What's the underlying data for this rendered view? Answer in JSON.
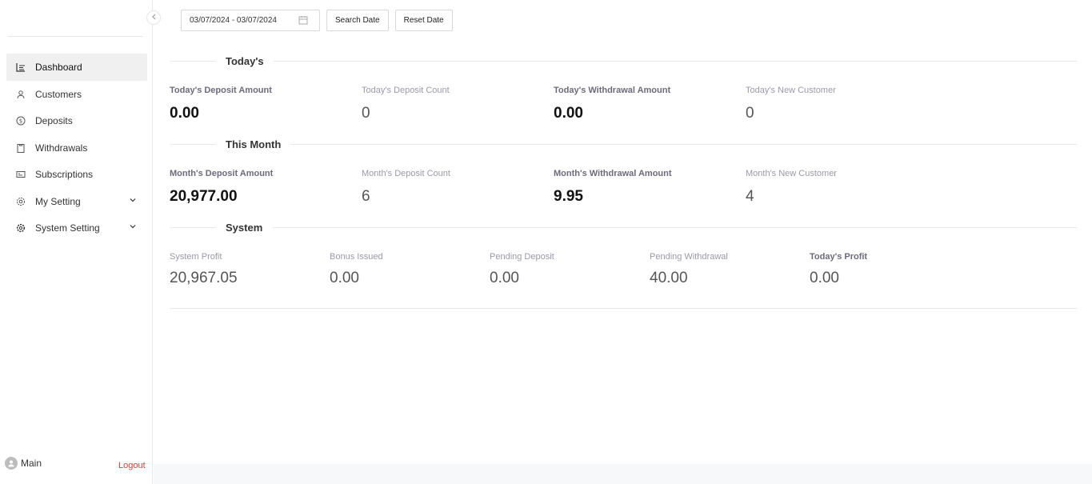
{
  "sidebar": {
    "items": [
      {
        "label": "Dashboard",
        "icon": "dashboard-icon",
        "active": true
      },
      {
        "label": "Customers",
        "icon": "user-icon"
      },
      {
        "label": "Deposits",
        "icon": "dollar-icon"
      },
      {
        "label": "Withdrawals",
        "icon": "clipboard-icon"
      },
      {
        "label": "Subscriptions",
        "icon": "card-icon"
      },
      {
        "label": "My Setting",
        "icon": "settings-icon",
        "expandable": true
      },
      {
        "label": "System Setting",
        "icon": "gear-icon",
        "expandable": true
      }
    ],
    "user_name": "Main",
    "logout_label": "Logout"
  },
  "toolbar": {
    "date_range": "03/07/2024 - 03/07/2024",
    "search_label": "Search Date",
    "reset_label": "Reset Date"
  },
  "todays": {
    "title": "Today's",
    "stats": [
      {
        "label": "Today's Deposit Amount",
        "value": "0.00"
      },
      {
        "label": "Today's Deposit Count",
        "value": "0"
      },
      {
        "label": "Today's Withdrawal Amount",
        "value": "0.00"
      },
      {
        "label": "Today's New Customer",
        "value": "0"
      }
    ]
  },
  "month": {
    "title": "This Month",
    "stats": [
      {
        "label": "Month's Deposit Amount",
        "value": "20,977.00"
      },
      {
        "label": "Month's Deposit Count",
        "value": "6"
      },
      {
        "label": "Month's Withdrawal Amount",
        "value": "9.95"
      },
      {
        "label": "Month's New Customer",
        "value": "4"
      }
    ]
  },
  "system": {
    "title": "System",
    "stats": [
      {
        "label": "System Profit",
        "value": "20,967.05"
      },
      {
        "label": "Bonus Issued",
        "value": "0.00"
      },
      {
        "label": "Pending Deposit",
        "value": "0.00"
      },
      {
        "label": "Pending Withdrawal",
        "value": "40.00"
      },
      {
        "label": "Today's Profit",
        "value": "0.00"
      }
    ]
  }
}
